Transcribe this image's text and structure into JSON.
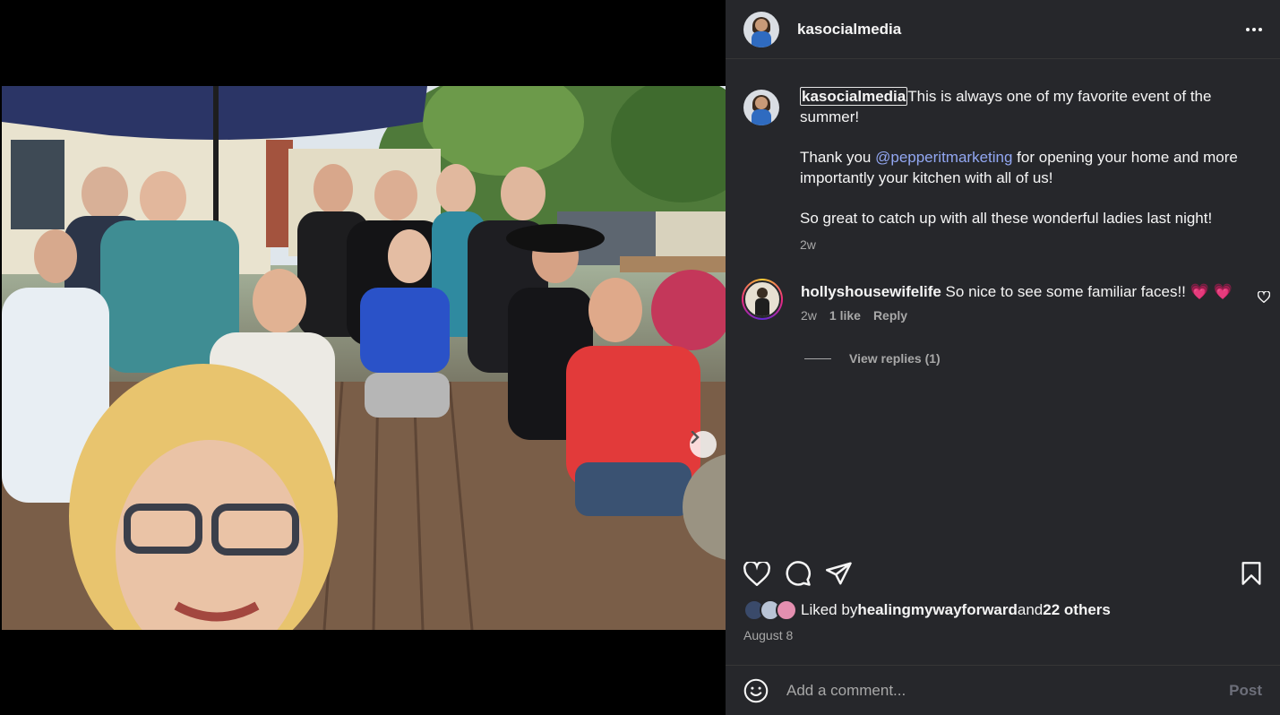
{
  "post": {
    "author": "kasocialmedia",
    "caption_text": "This is always one of my favorite event of the summer!",
    "caption_line2_prefix": "Thank you ",
    "caption_mention": "@pepperitmarketing",
    "caption_line2_suffix": " for opening your home and more importantly your kitchen with all of us!",
    "caption_line3": "So great to catch up with all these wonderful ladies last night!",
    "caption_time": "2w",
    "date": "August 8"
  },
  "comments": [
    {
      "user": "hollyshousewifelife",
      "text": "So nice to see some familiar faces!!",
      "emoji": "💗 💗",
      "time": "2w",
      "likes": "1 like",
      "reply_label": "Reply",
      "view_replies": "View replies (1)"
    }
  ],
  "likes": {
    "prefix": "Liked by ",
    "user": "healingmywayforward",
    "middle": " and ",
    "others": "22 others",
    "avatar_colors": [
      "#3a4a6a",
      "#b9c4d6",
      "#e48fb0"
    ]
  },
  "add_comment": {
    "placeholder": "Add a comment...",
    "post_label": "Post"
  },
  "carousel": {
    "slide_count": 2,
    "active_index": 0
  },
  "colors": {
    "panel_bg": "#26272b",
    "mention": "#92a7f2",
    "muted": "#a8a8a8",
    "heart_pink": "#ff4f9a"
  }
}
